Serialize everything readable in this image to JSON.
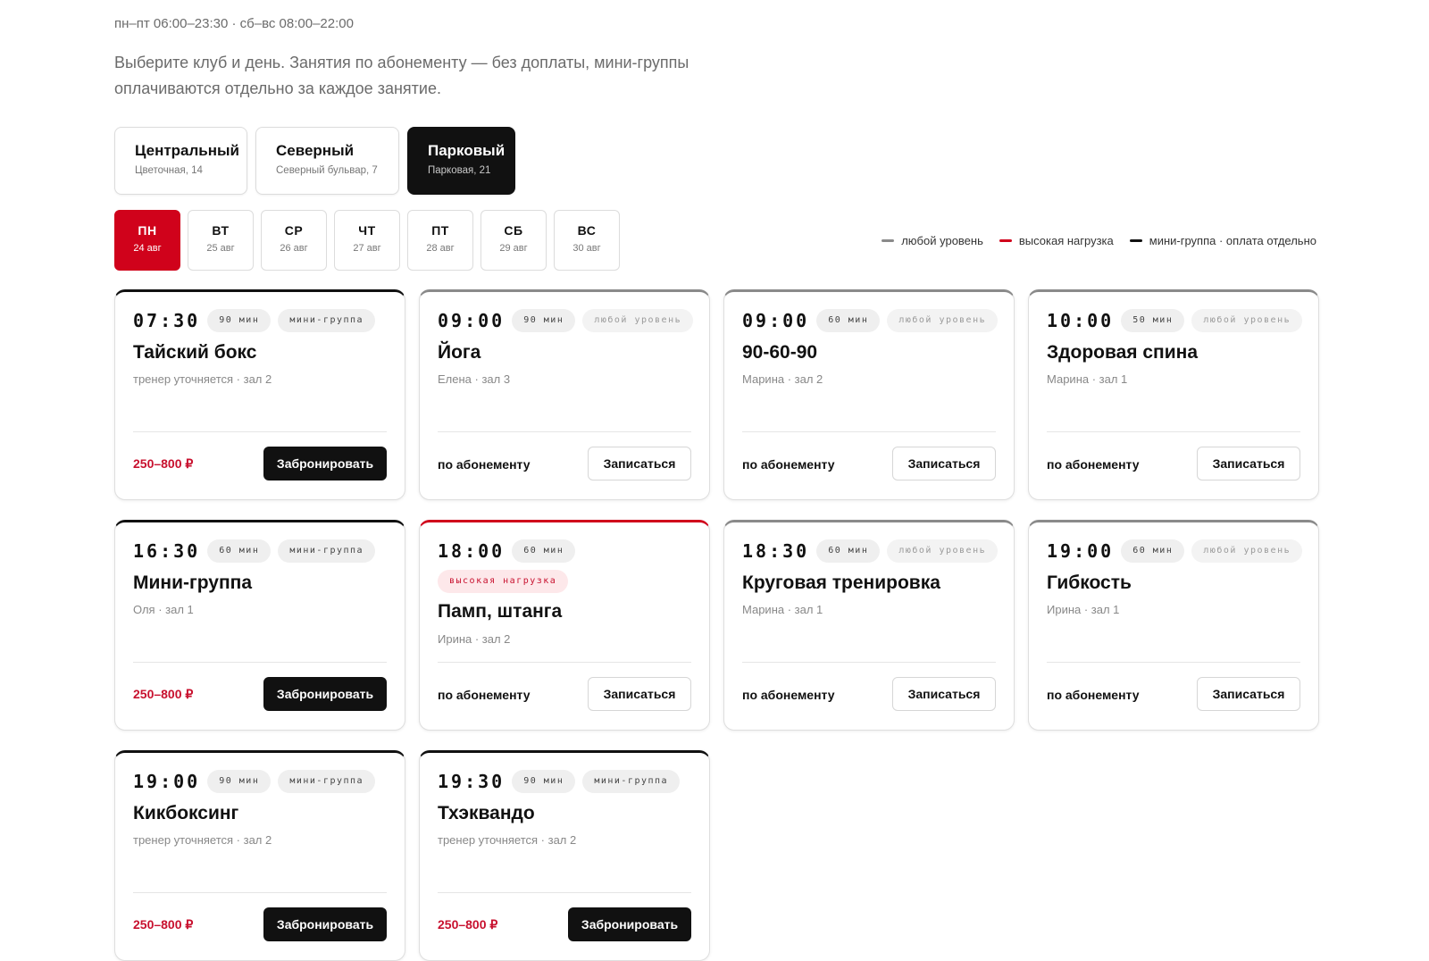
{
  "header": {
    "hours": "пн–пт 06:00–23:30 · сб–вс 08:00–22:00",
    "intro": "Выберите клуб и день. Занятия по абонементу — без доплаты, мини-группы оплачиваются отдельно за каждое занятие."
  },
  "clubs": [
    {
      "name": "Центральный",
      "address": "Цветочная, 14",
      "active": false
    },
    {
      "name": "Северный",
      "address": "Северный бульвар, 7",
      "active": false
    },
    {
      "name": "Парковый",
      "address": "Парковая, 21",
      "active": true
    }
  ],
  "days": [
    {
      "name": "ПН",
      "date": "24 авг",
      "active": true
    },
    {
      "name": "ВТ",
      "date": "25 авг",
      "active": false
    },
    {
      "name": "СР",
      "date": "26 авг",
      "active": false
    },
    {
      "name": "ЧТ",
      "date": "27 авг",
      "active": false
    },
    {
      "name": "ПТ",
      "date": "28 авг",
      "active": false
    },
    {
      "name": "СБ",
      "date": "29 авг",
      "active": false
    },
    {
      "name": "ВС",
      "date": "30 авг",
      "active": false
    }
  ],
  "legend": [
    {
      "label": "любой уровень",
      "color": "#8a8a8a"
    },
    {
      "label": "высокая нагрузка",
      "color": "#d0021b"
    },
    {
      "label": "мини-группа · оплата отдельно",
      "color": "#111111"
    }
  ],
  "colors": {
    "accent": "#d0021b",
    "dark": "#111111",
    "any_level": "#8a8a8a"
  },
  "classes": [
    {
      "kind": "mini",
      "time": "07:30",
      "duration": "90 мин",
      "tag": "мини-группа",
      "title": "Тайский бокс",
      "meta": "тренер уточняется · зал 2",
      "price": "250–800 ₽",
      "button": "Забронировать"
    },
    {
      "kind": "any",
      "time": "09:00",
      "duration": "90 мин",
      "tag": "любой уровень",
      "title": "Йога",
      "meta": "Елена · зал 3",
      "price": "по абонементу",
      "button": "Записаться"
    },
    {
      "kind": "any",
      "time": "09:00",
      "duration": "60 мин",
      "tag": "любой уровень",
      "title": "90-60-90",
      "meta": "Марина · зал 2",
      "price": "по абонементу",
      "button": "Записаться"
    },
    {
      "kind": "any",
      "time": "10:00",
      "duration": "50 мин",
      "tag": "любой уровень",
      "title": "Здоровая спина",
      "meta": "Марина · зал 1",
      "price": "по абонементу",
      "button": "Записаться"
    },
    {
      "kind": "mini",
      "time": "16:30",
      "duration": "60 мин",
      "tag": "мини-группа",
      "title": "Мини-группа",
      "meta": "Оля · зал 1",
      "price": "250–800 ₽",
      "button": "Забронировать"
    },
    {
      "kind": "high",
      "time": "18:00",
      "duration": "60 мин",
      "tag": "высокая нагрузка",
      "title": "Памп, штанга",
      "meta": "Ирина · зал 2",
      "price": "по абонементу",
      "button": "Записаться"
    },
    {
      "kind": "any",
      "time": "18:30",
      "duration": "60 мин",
      "tag": "любой уровень",
      "title": "Круговая тренировка",
      "meta": "Марина · зал 1",
      "price": "по абонементу",
      "button": "Записаться"
    },
    {
      "kind": "any",
      "time": "19:00",
      "duration": "60 мин",
      "tag": "любой уровень",
      "title": "Гибкость",
      "meta": "Ирина · зал 1",
      "price": "по абонементу",
      "button": "Записаться"
    },
    {
      "kind": "mini",
      "time": "19:00",
      "duration": "90 мин",
      "tag": "мини-группа",
      "title": "Кикбоксинг",
      "meta": "тренер уточняется · зал 2",
      "price": "250–800 ₽",
      "button": "Забронировать"
    },
    {
      "kind": "mini",
      "time": "19:30",
      "duration": "90 мин",
      "tag": "мини-группа",
      "title": "Тхэквандо",
      "meta": "тренер уточняется · зал 2",
      "price": "250–800 ₽",
      "button": "Забронировать"
    }
  ]
}
